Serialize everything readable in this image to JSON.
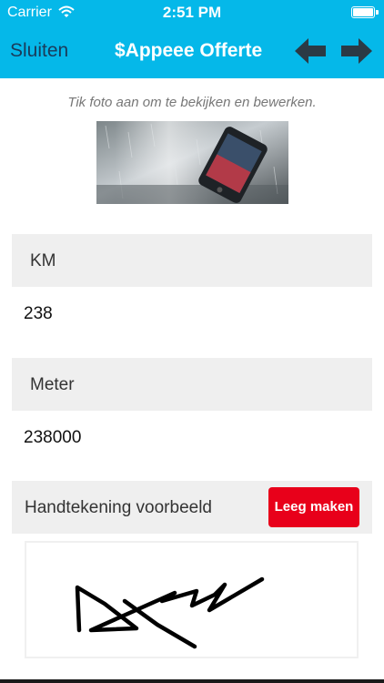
{
  "status_bar": {
    "carrier": "Carrier",
    "time": "2:51 PM"
  },
  "navbar": {
    "close_label": "Sluiten",
    "title": "$Appeee Offerte",
    "back_icon": "arrow-left-icon",
    "forward_icon": "arrow-right-icon"
  },
  "photo": {
    "hint": "Tik foto aan om te bekijken en bewerken."
  },
  "fields": [
    {
      "label": "KM",
      "value": "238"
    },
    {
      "label": "Meter",
      "value": "238000"
    }
  ],
  "signature": {
    "label": "Handtekening voorbeeld",
    "clear_label": "Leeg maken"
  },
  "colors": {
    "nav_bg": "#05b8e9",
    "accent_red": "#e8001a",
    "section_bg": "#efefef"
  }
}
